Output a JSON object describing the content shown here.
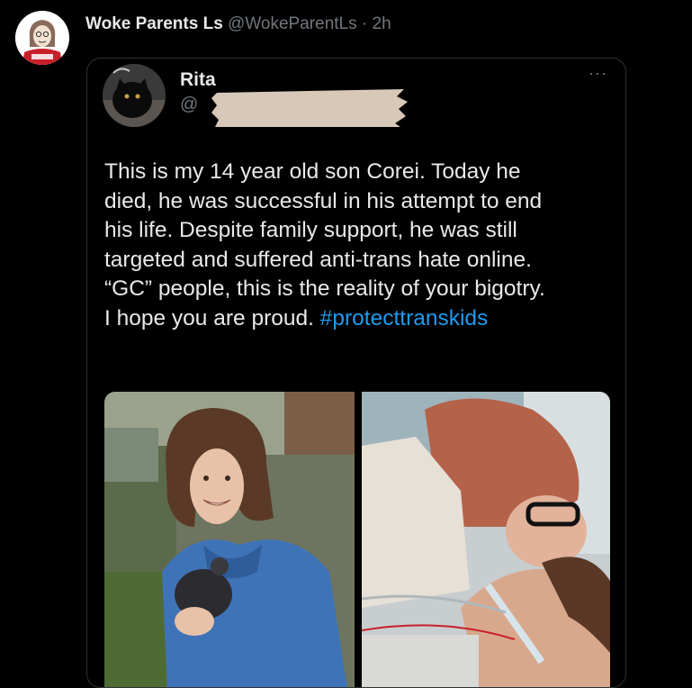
{
  "retweeter": {
    "display_name": "Woke Parents Ls",
    "handle": "@WokeParentLs",
    "separator": " · ",
    "time": "2h",
    "avatar_icon": "cartoon-avatar-icon"
  },
  "quoted": {
    "display_name": "Rita",
    "handle": "@",
    "more_label": "···",
    "lines": [
      "This is my 14 year old son Corei. Today he",
      "died, he was successful in his attempt to end",
      "his life. Despite family support, he was still",
      "targeted and suffered anti-trans hate online.",
      "“GC” people, this is the reality of your bigotry.",
      "I hope you are proud. "
    ],
    "hashtag": "#protecttranskids",
    "hashtag_color": "#1d9bf0"
  },
  "colors": {
    "background": "#000000",
    "text": "#e7e9ea",
    "secondary": "#71767b",
    "border": "#2f3336",
    "redaction": "#d8c8b8"
  }
}
